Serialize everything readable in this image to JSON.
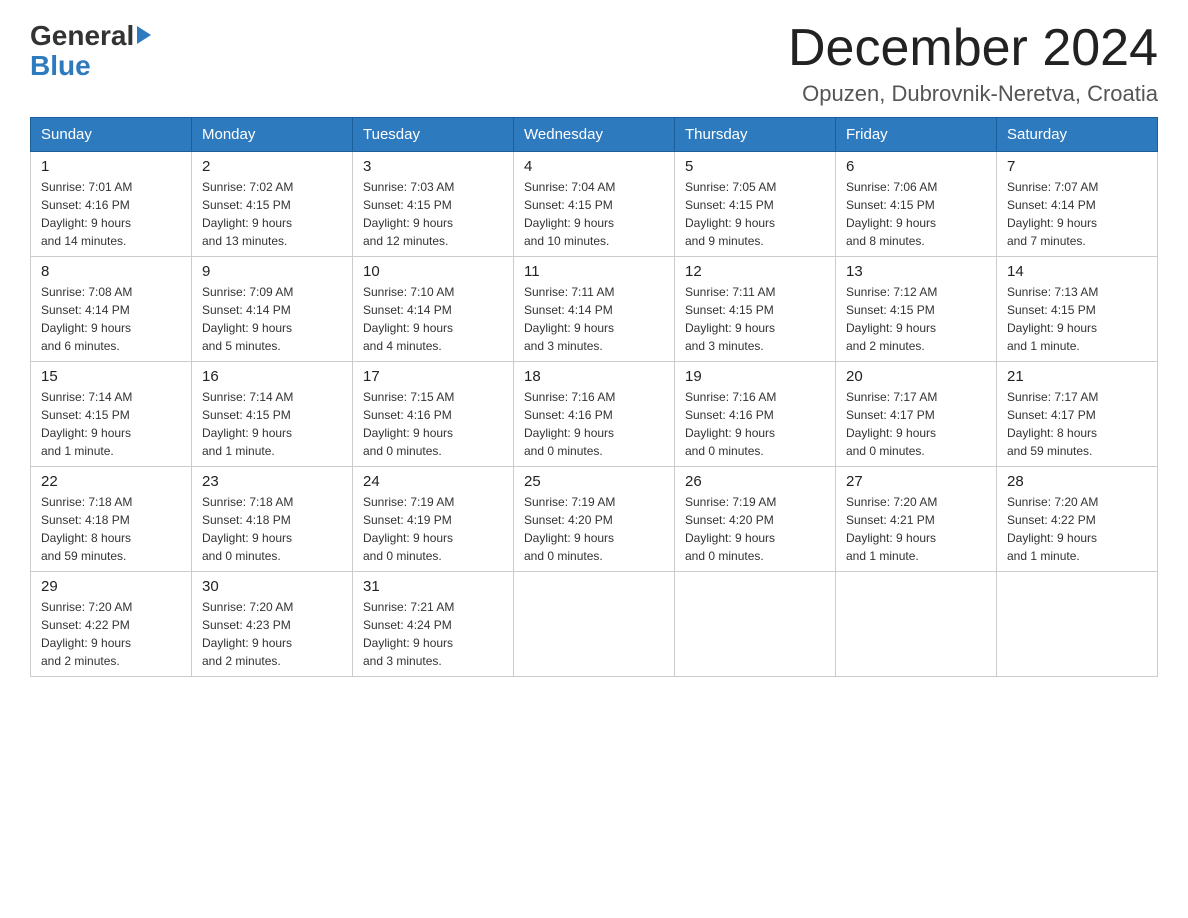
{
  "header": {
    "logo_general": "General",
    "logo_blue": "Blue",
    "month_title": "December 2024",
    "location": "Opuzen, Dubrovnik-Neretva, Croatia"
  },
  "days_of_week": [
    "Sunday",
    "Monday",
    "Tuesday",
    "Wednesday",
    "Thursday",
    "Friday",
    "Saturday"
  ],
  "weeks": [
    [
      {
        "day": "1",
        "sunrise": "7:01 AM",
        "sunset": "4:16 PM",
        "daylight": "9 hours and 14 minutes."
      },
      {
        "day": "2",
        "sunrise": "7:02 AM",
        "sunset": "4:15 PM",
        "daylight": "9 hours and 13 minutes."
      },
      {
        "day": "3",
        "sunrise": "7:03 AM",
        "sunset": "4:15 PM",
        "daylight": "9 hours and 12 minutes."
      },
      {
        "day": "4",
        "sunrise": "7:04 AM",
        "sunset": "4:15 PM",
        "daylight": "9 hours and 10 minutes."
      },
      {
        "day": "5",
        "sunrise": "7:05 AM",
        "sunset": "4:15 PM",
        "daylight": "9 hours and 9 minutes."
      },
      {
        "day": "6",
        "sunrise": "7:06 AM",
        "sunset": "4:15 PM",
        "daylight": "9 hours and 8 minutes."
      },
      {
        "day": "7",
        "sunrise": "7:07 AM",
        "sunset": "4:14 PM",
        "daylight": "9 hours and 7 minutes."
      }
    ],
    [
      {
        "day": "8",
        "sunrise": "7:08 AM",
        "sunset": "4:14 PM",
        "daylight": "9 hours and 6 minutes."
      },
      {
        "day": "9",
        "sunrise": "7:09 AM",
        "sunset": "4:14 PM",
        "daylight": "9 hours and 5 minutes."
      },
      {
        "day": "10",
        "sunrise": "7:10 AM",
        "sunset": "4:14 PM",
        "daylight": "9 hours and 4 minutes."
      },
      {
        "day": "11",
        "sunrise": "7:11 AM",
        "sunset": "4:14 PM",
        "daylight": "9 hours and 3 minutes."
      },
      {
        "day": "12",
        "sunrise": "7:11 AM",
        "sunset": "4:15 PM",
        "daylight": "9 hours and 3 minutes."
      },
      {
        "day": "13",
        "sunrise": "7:12 AM",
        "sunset": "4:15 PM",
        "daylight": "9 hours and 2 minutes."
      },
      {
        "day": "14",
        "sunrise": "7:13 AM",
        "sunset": "4:15 PM",
        "daylight": "9 hours and 1 minute."
      }
    ],
    [
      {
        "day": "15",
        "sunrise": "7:14 AM",
        "sunset": "4:15 PM",
        "daylight": "9 hours and 1 minute."
      },
      {
        "day": "16",
        "sunrise": "7:14 AM",
        "sunset": "4:15 PM",
        "daylight": "9 hours and 1 minute."
      },
      {
        "day": "17",
        "sunrise": "7:15 AM",
        "sunset": "4:16 PM",
        "daylight": "9 hours and 0 minutes."
      },
      {
        "day": "18",
        "sunrise": "7:16 AM",
        "sunset": "4:16 PM",
        "daylight": "9 hours and 0 minutes."
      },
      {
        "day": "19",
        "sunrise": "7:16 AM",
        "sunset": "4:16 PM",
        "daylight": "9 hours and 0 minutes."
      },
      {
        "day": "20",
        "sunrise": "7:17 AM",
        "sunset": "4:17 PM",
        "daylight": "9 hours and 0 minutes."
      },
      {
        "day": "21",
        "sunrise": "7:17 AM",
        "sunset": "4:17 PM",
        "daylight": "8 hours and 59 minutes."
      }
    ],
    [
      {
        "day": "22",
        "sunrise": "7:18 AM",
        "sunset": "4:18 PM",
        "daylight": "8 hours and 59 minutes."
      },
      {
        "day": "23",
        "sunrise": "7:18 AM",
        "sunset": "4:18 PM",
        "daylight": "9 hours and 0 minutes."
      },
      {
        "day": "24",
        "sunrise": "7:19 AM",
        "sunset": "4:19 PM",
        "daylight": "9 hours and 0 minutes."
      },
      {
        "day": "25",
        "sunrise": "7:19 AM",
        "sunset": "4:20 PM",
        "daylight": "9 hours and 0 minutes."
      },
      {
        "day": "26",
        "sunrise": "7:19 AM",
        "sunset": "4:20 PM",
        "daylight": "9 hours and 0 minutes."
      },
      {
        "day": "27",
        "sunrise": "7:20 AM",
        "sunset": "4:21 PM",
        "daylight": "9 hours and 1 minute."
      },
      {
        "day": "28",
        "sunrise": "7:20 AM",
        "sunset": "4:22 PM",
        "daylight": "9 hours and 1 minute."
      }
    ],
    [
      {
        "day": "29",
        "sunrise": "7:20 AM",
        "sunset": "4:22 PM",
        "daylight": "9 hours and 2 minutes."
      },
      {
        "day": "30",
        "sunrise": "7:20 AM",
        "sunset": "4:23 PM",
        "daylight": "9 hours and 2 minutes."
      },
      {
        "day": "31",
        "sunrise": "7:21 AM",
        "sunset": "4:24 PM",
        "daylight": "9 hours and 3 minutes."
      },
      null,
      null,
      null,
      null
    ]
  ],
  "labels": {
    "sunrise": "Sunrise:",
    "sunset": "Sunset:",
    "daylight": "Daylight:"
  }
}
